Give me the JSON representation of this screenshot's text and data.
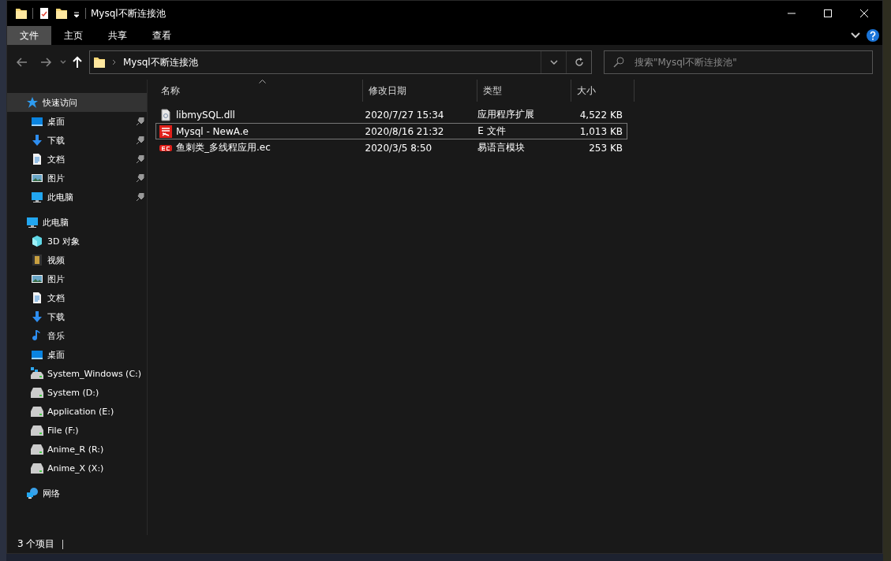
{
  "window": {
    "title": "Mysql不断连接池"
  },
  "ribbon_tabs": [
    {
      "label": "文件",
      "selected": true
    },
    {
      "label": "主页",
      "selected": false
    },
    {
      "label": "共享",
      "selected": false
    },
    {
      "label": "查看",
      "selected": false
    }
  ],
  "address": {
    "path": "Mysql不断连接池"
  },
  "search": {
    "placeholder": "搜索\"Mysql不断连接池\""
  },
  "sidebar": {
    "items": [
      {
        "label": "快速访问",
        "kind": "star",
        "selected": true,
        "children": [
          {
            "label": "桌面",
            "kind": "desktop",
            "selected": false,
            "pinned": true
          },
          {
            "label": "下载",
            "kind": "download",
            "selected": false,
            "pinned": true
          },
          {
            "label": "文档",
            "kind": "document",
            "selected": false,
            "pinned": true
          },
          {
            "label": "图片",
            "kind": "pictures",
            "selected": false,
            "pinned": true
          },
          {
            "label": "此电脑",
            "kind": "pc",
            "selected": false,
            "pinned": true
          }
        ]
      },
      {
        "label": "此电脑",
        "kind": "pc",
        "selected": false,
        "children": [
          {
            "label": "3D 对象",
            "kind": "cube",
            "selected": false
          },
          {
            "label": "视频",
            "kind": "video",
            "selected": false
          },
          {
            "label": "图片",
            "kind": "pictures",
            "selected": false
          },
          {
            "label": "文档",
            "kind": "document",
            "selected": false
          },
          {
            "label": "下载",
            "kind": "download",
            "selected": false
          },
          {
            "label": "音乐",
            "kind": "music",
            "selected": false
          },
          {
            "label": "桌面",
            "kind": "desktop",
            "selected": false
          },
          {
            "label": "System_Windows (C:)",
            "kind": "system-drive",
            "selected": false
          },
          {
            "label": "System (D:)",
            "kind": "drive",
            "selected": false
          },
          {
            "label": "Application (E:)",
            "kind": "drive",
            "selected": false
          },
          {
            "label": "File (F:)",
            "kind": "drive",
            "selected": false
          },
          {
            "label": "Anime_R (R:)",
            "kind": "drive",
            "selected": false
          },
          {
            "label": "Anime_X (X:)",
            "kind": "drive",
            "selected": false
          }
        ]
      },
      {
        "label": "网络",
        "kind": "network",
        "selected": false
      }
    ]
  },
  "table": {
    "columns": [
      {
        "label": "名称",
        "sorted": true
      },
      {
        "label": "修改日期",
        "sorted": false
      },
      {
        "label": "类型",
        "sorted": false
      },
      {
        "label": "大小",
        "sorted": false
      }
    ],
    "rows": [
      {
        "kind": "dll",
        "name": "libmySQL.dll",
        "date": "2020/7/27 15:34",
        "type": "应用程序扩展",
        "size": "4,522 KB",
        "focused": false
      },
      {
        "kind": "e",
        "name": "Mysql - NewA.e",
        "date": "2020/8/16 21:32",
        "type": "E 文件",
        "size": "1,013 KB",
        "focused": true
      },
      {
        "kind": "ec",
        "name": "鱼刺类_多线程应用.ec",
        "date": "2020/3/5 8:50",
        "type": "易语言模块",
        "size": "253 KB",
        "focused": false
      }
    ]
  },
  "status_bar": {
    "count": "3 个项目"
  }
}
